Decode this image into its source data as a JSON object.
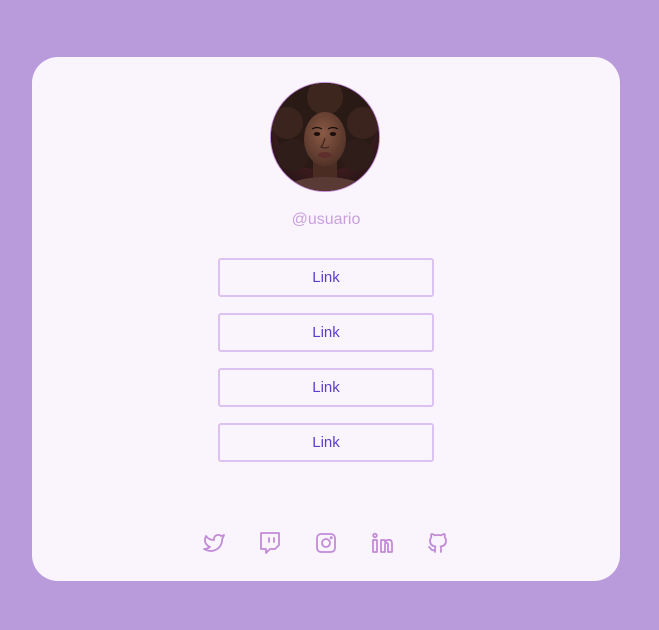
{
  "profile": {
    "username": "@usuario"
  },
  "links": [
    {
      "label": "Link"
    },
    {
      "label": "Link"
    },
    {
      "label": "Link"
    },
    {
      "label": "Link"
    }
  ],
  "socials": [
    {
      "icon": "twitter-icon"
    },
    {
      "icon": "twitch-icon"
    },
    {
      "icon": "instagram-icon"
    },
    {
      "icon": "linkedin-icon"
    },
    {
      "icon": "github-icon"
    }
  ],
  "colors": {
    "background": "#b99bdc",
    "card": "#faf5fd",
    "accent": "#c28bd7",
    "link_text": "#5b3fc8",
    "link_border": "#dcc2ee",
    "username": "#c9a0dc"
  }
}
